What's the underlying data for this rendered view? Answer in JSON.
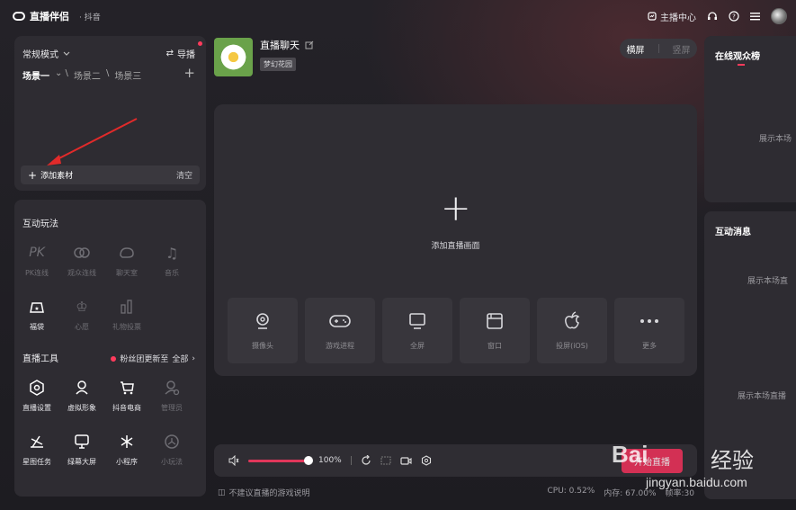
{
  "app": {
    "title": "直播伴侣",
    "subtitle": "· 抖音"
  },
  "topbar": {
    "creator_center": "主播中心"
  },
  "scene_panel": {
    "mode": "常规模式",
    "guide": "导播",
    "scenes": [
      "场景一",
      "场景二",
      "场景三"
    ],
    "add_material": "添加素材",
    "clear": "清空"
  },
  "interaction": {
    "title": "互动玩法",
    "items": [
      {
        "label": "PK连线",
        "icon": "pk-icon",
        "enabled": false
      },
      {
        "label": "观众连线",
        "icon": "link-icon",
        "enabled": false
      },
      {
        "label": "聊天室",
        "icon": "chat-icon",
        "enabled": false
      },
      {
        "label": "音乐",
        "icon": "music-icon",
        "enabled": false
      },
      {
        "label": "福袋",
        "icon": "lucky-bag-icon",
        "enabled": true
      },
      {
        "label": "心愿",
        "icon": "wish-icon",
        "enabled": false
      },
      {
        "label": "礼物投票",
        "icon": "vote-icon",
        "enabled": false
      }
    ]
  },
  "tools": {
    "title": "直播工具",
    "fan_note": "粉丝团更新至",
    "all": "全部",
    "items": [
      {
        "label": "直播设置",
        "icon": "settings-icon",
        "enabled": true
      },
      {
        "label": "虚拟形象",
        "icon": "avatar-icon",
        "enabled": true
      },
      {
        "label": "抖音电商",
        "icon": "cart-icon",
        "enabled": true
      },
      {
        "label": "管理员",
        "icon": "admin-icon",
        "enabled": false
      },
      {
        "label": "星图任务",
        "icon": "star-task-icon",
        "enabled": true
      },
      {
        "label": "绿幕大屏",
        "icon": "screen-icon",
        "enabled": true
      },
      {
        "label": "小程序",
        "icon": "mini-program-icon",
        "enabled": true
      },
      {
        "label": "小玩法",
        "icon": "mini-game-icon",
        "enabled": false
      }
    ]
  },
  "room": {
    "name": "直播聊天",
    "tag": "梦幻花园"
  },
  "orientation": {
    "landscape": "横屏",
    "portrait": "竖屏"
  },
  "stage": {
    "add_label": "添加直播画面",
    "sources": [
      {
        "label": "摄像头",
        "icon": "camera-icon"
      },
      {
        "label": "游戏进程",
        "icon": "gamepad-icon"
      },
      {
        "label": "全屏",
        "icon": "monitor-icon"
      },
      {
        "label": "窗口",
        "icon": "window-icon"
      },
      {
        "label": "投屏(iOS)",
        "icon": "apple-icon"
      },
      {
        "label": "更多",
        "icon": "more-icon"
      }
    ]
  },
  "controls": {
    "volume": "100%",
    "volume_level": 1.0,
    "start": "开始直播"
  },
  "status": {
    "notice": "不建议直播的游戏说明",
    "cpu": "CPU: 0.52%",
    "mem": "内存: 67.00%",
    "fps": "帧率:30"
  },
  "viewers": {
    "title": "在线观众榜",
    "placeholder": "展示本场"
  },
  "messages": {
    "title": "互动消息",
    "placeholder1": "展示本场直",
    "placeholder2": "展示本场直播"
  },
  "watermark": {
    "brand": "Bai",
    "cn": "经验",
    "url": "jingyan.baidu.com"
  },
  "colors": {
    "accent": "#f0315a",
    "panel": "#2e2c32",
    "background": "#1c1b20"
  }
}
